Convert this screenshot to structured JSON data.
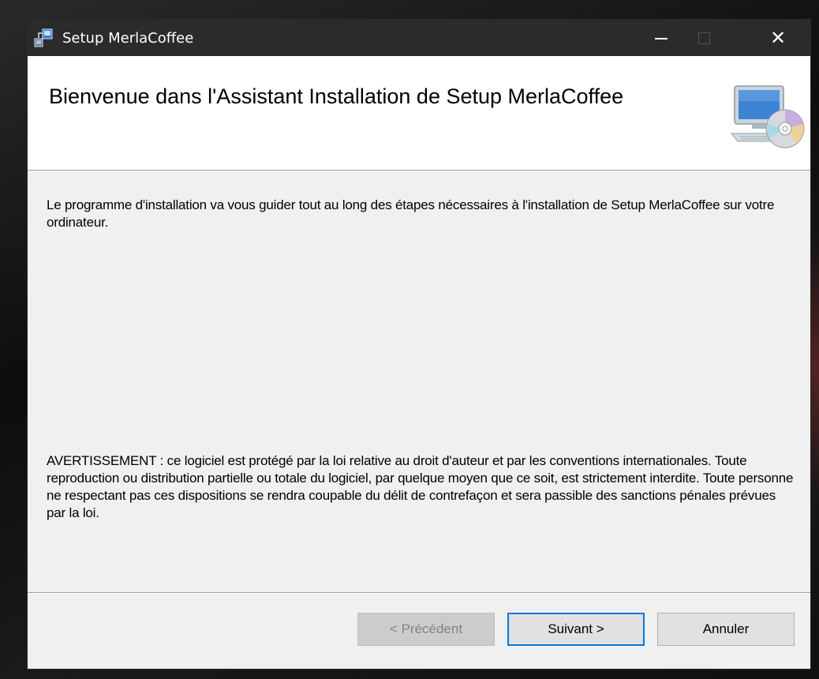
{
  "window": {
    "title": "Setup MerlaCoffee"
  },
  "titlebar_controls": {
    "minimize_icon": "minimize-icon",
    "maximize_icon": "maximize-icon",
    "close_icon": "close-icon",
    "close_glyph": "✕"
  },
  "header": {
    "heading": "Bienvenue dans l'Assistant Installation de Setup MerlaCoffee",
    "icon": "computer-cd-icon"
  },
  "body": {
    "intro": "Le programme d'installation va vous guider tout au long des étapes nécessaires à l'installation de Setup MerlaCoffee sur votre ordinateur.",
    "warning": "AVERTISSEMENT : ce logiciel est protégé par la loi relative au droit d'auteur et par les conventions internationales. Toute reproduction ou distribution partielle ou totale du logiciel, par quelque moyen que ce soit, est strictement interdite. Toute personne ne respectant pas ces dispositions se rendra coupable du délit de contrefaçon et sera passible des sanctions pénales prévues par la loi."
  },
  "buttons": {
    "previous": "< Précédent",
    "previous_enabled": false,
    "next": "Suivant >",
    "cancel": "Annuler"
  },
  "colors": {
    "titlebar": "#2b2b2b",
    "focus_accent": "#0078d7",
    "dialog_background": "#f0f0f0"
  }
}
